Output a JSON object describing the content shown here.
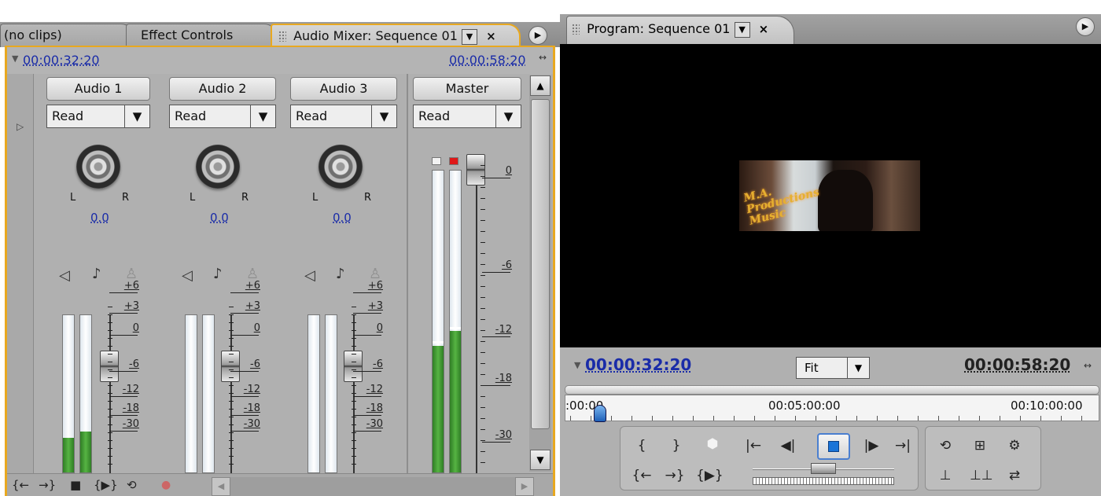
{
  "left_tabs": {
    "clips_tab": "(no clips)",
    "effect_controls_tab": "Effect Controls",
    "audio_mixer_tab": "Audio Mixer: Sequence 01",
    "dropdown_glyph": "▼",
    "close_glyph": "×",
    "menu_glyph": "▶"
  },
  "mixer": {
    "current_time": "00:00:32:20",
    "duration": "00:00:58:20",
    "tracks": [
      {
        "name": "Audio 1",
        "mode": "Read",
        "pan": "0.0",
        "meter_left": 0.22,
        "meter_right": 0.26
      },
      {
        "name": "Audio 2",
        "mode": "Read",
        "pan": "0.0",
        "meter_left": 0,
        "meter_right": 0
      },
      {
        "name": "Audio 3",
        "mode": "Read",
        "pan": "0.0",
        "meter_left": 0,
        "meter_right": 0
      }
    ],
    "master": {
      "name": "Master",
      "mode": "Read",
      "meter_left": 0.42,
      "meter_right": 0.47
    },
    "pan_left_label": "L",
    "pan_right_label": "R",
    "track_scale": [
      "+6",
      "+3",
      "0",
      "-6",
      "-12",
      "-18",
      "-30"
    ],
    "master_scale": [
      "0",
      "-6",
      "-12",
      "-18",
      "-30"
    ],
    "colors": {
      "accent": "#e8a820",
      "link": "#1a2ca8",
      "meter": "#3f9a30"
    }
  },
  "program": {
    "tab_label": "Program: Sequence 01",
    "current_time": "00:00:32:20",
    "duration": "00:00:58:20",
    "fit_value": "Fit",
    "ruler_labels": [
      ":00:00",
      "00:05:00:00",
      "00:10:00:00"
    ],
    "video_logo_text": "M.A. Productions Music"
  }
}
